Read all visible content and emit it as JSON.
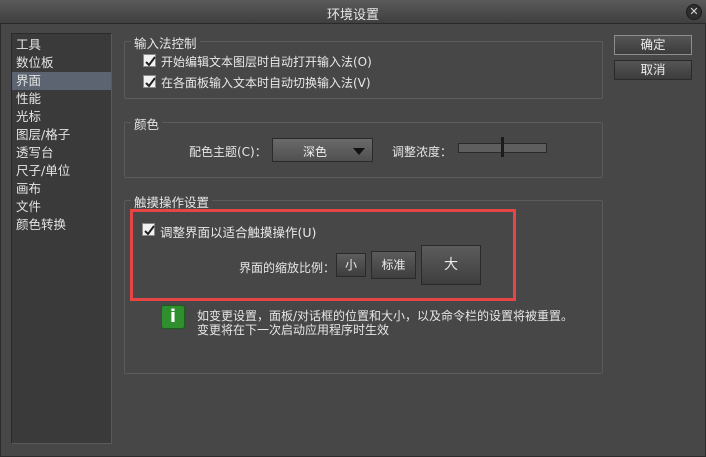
{
  "window": {
    "title": "环境设置",
    "close_glyph": "✕"
  },
  "sidebar": {
    "items": [
      {
        "label": "工具"
      },
      {
        "label": "数位板"
      },
      {
        "label": "界面"
      },
      {
        "label": "性能"
      },
      {
        "label": "光标"
      },
      {
        "label": "图层/格子"
      },
      {
        "label": "透写台"
      },
      {
        "label": "尺子/单位"
      },
      {
        "label": "画布"
      },
      {
        "label": "文件"
      },
      {
        "label": "颜色转换"
      }
    ],
    "selected": "界面"
  },
  "buttons": {
    "ok": "确定",
    "cancel": "取消"
  },
  "ime_group": {
    "title": "输入法控制",
    "opt1": {
      "label": "开始编辑文本图层时自动打开输入法(O)",
      "checked": true
    },
    "opt2": {
      "label": "在各面板输入文本时自动切换输入法(V)",
      "checked": true
    }
  },
  "color_group": {
    "title": "颜色",
    "theme_label": "配色主题(C)：",
    "theme_value": "深色",
    "density_label": "调整浓度：",
    "density_value": 0.5
  },
  "touch_group": {
    "title": "触摸操作设置",
    "touch_opt": {
      "label": "调整界面以适合触摸操作(U)",
      "checked": true
    },
    "scale_label": "界面的缩放比例：",
    "scale_small": "小",
    "scale_standard": "标准",
    "scale_large": "大",
    "info_icon_glyph": "i",
    "info_line1": "如变更设置，面板/对话框的位置和大小，以及命令栏的设置将被重置。",
    "info_line2": "变更将在下一次启动应用程序时生效"
  },
  "colors": {
    "accent_highlight": "#e64545",
    "selected_item": "#5b6470",
    "info_green": "#2f8f2f"
  }
}
